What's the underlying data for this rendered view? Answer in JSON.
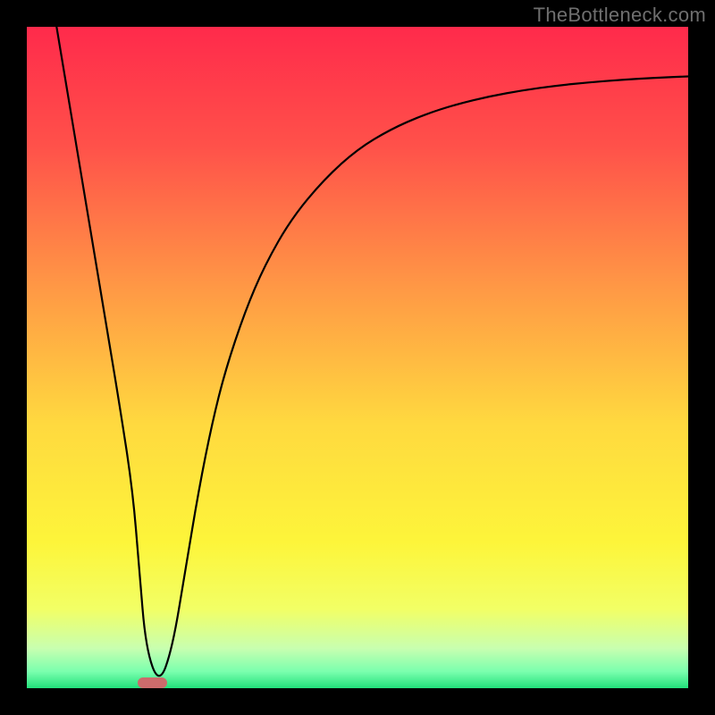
{
  "watermark": "TheBottleneck.com",
  "chart_data": {
    "type": "line",
    "title": "",
    "xlabel": "",
    "ylabel": "",
    "xlim": [
      0,
      100
    ],
    "ylim": [
      0,
      100
    ],
    "grid": false,
    "legend": false,
    "gradient_stops": [
      {
        "offset": 0.0,
        "color": "#ff2a4b"
      },
      {
        "offset": 0.18,
        "color": "#ff514a"
      },
      {
        "offset": 0.4,
        "color": "#ff9a45"
      },
      {
        "offset": 0.6,
        "color": "#ffd93f"
      },
      {
        "offset": 0.78,
        "color": "#fdf53a"
      },
      {
        "offset": 0.88,
        "color": "#f2ff65"
      },
      {
        "offset": 0.94,
        "color": "#c8ffb0"
      },
      {
        "offset": 0.975,
        "color": "#7affae"
      },
      {
        "offset": 1.0,
        "color": "#22e07a"
      }
    ],
    "series": [
      {
        "name": "bottleneck-curve",
        "type": "line",
        "x": [
          4.5,
          6,
          8,
          10,
          12,
          14,
          16,
          17,
          18,
          20,
          22,
          24,
          26,
          28,
          30,
          33,
          36,
          40,
          45,
          50,
          55,
          60,
          65,
          70,
          75,
          80,
          85,
          90,
          95,
          100
        ],
        "y": [
          100,
          91,
          79,
          67,
          55,
          43,
          30,
          18,
          6,
          0.5,
          6,
          18,
          30,
          40,
          48,
          57,
          64,
          71,
          77,
          81.5,
          84.5,
          86.7,
          88.3,
          89.5,
          90.4,
          91.1,
          91.6,
          92,
          92.3,
          92.5
        ]
      }
    ],
    "marker": {
      "name": "optimal-point",
      "x_center_pct": 19,
      "y_center_pct": 0.8,
      "width_pct": 4.5,
      "height_pct": 1.6,
      "color": "#cc6b6b"
    }
  }
}
